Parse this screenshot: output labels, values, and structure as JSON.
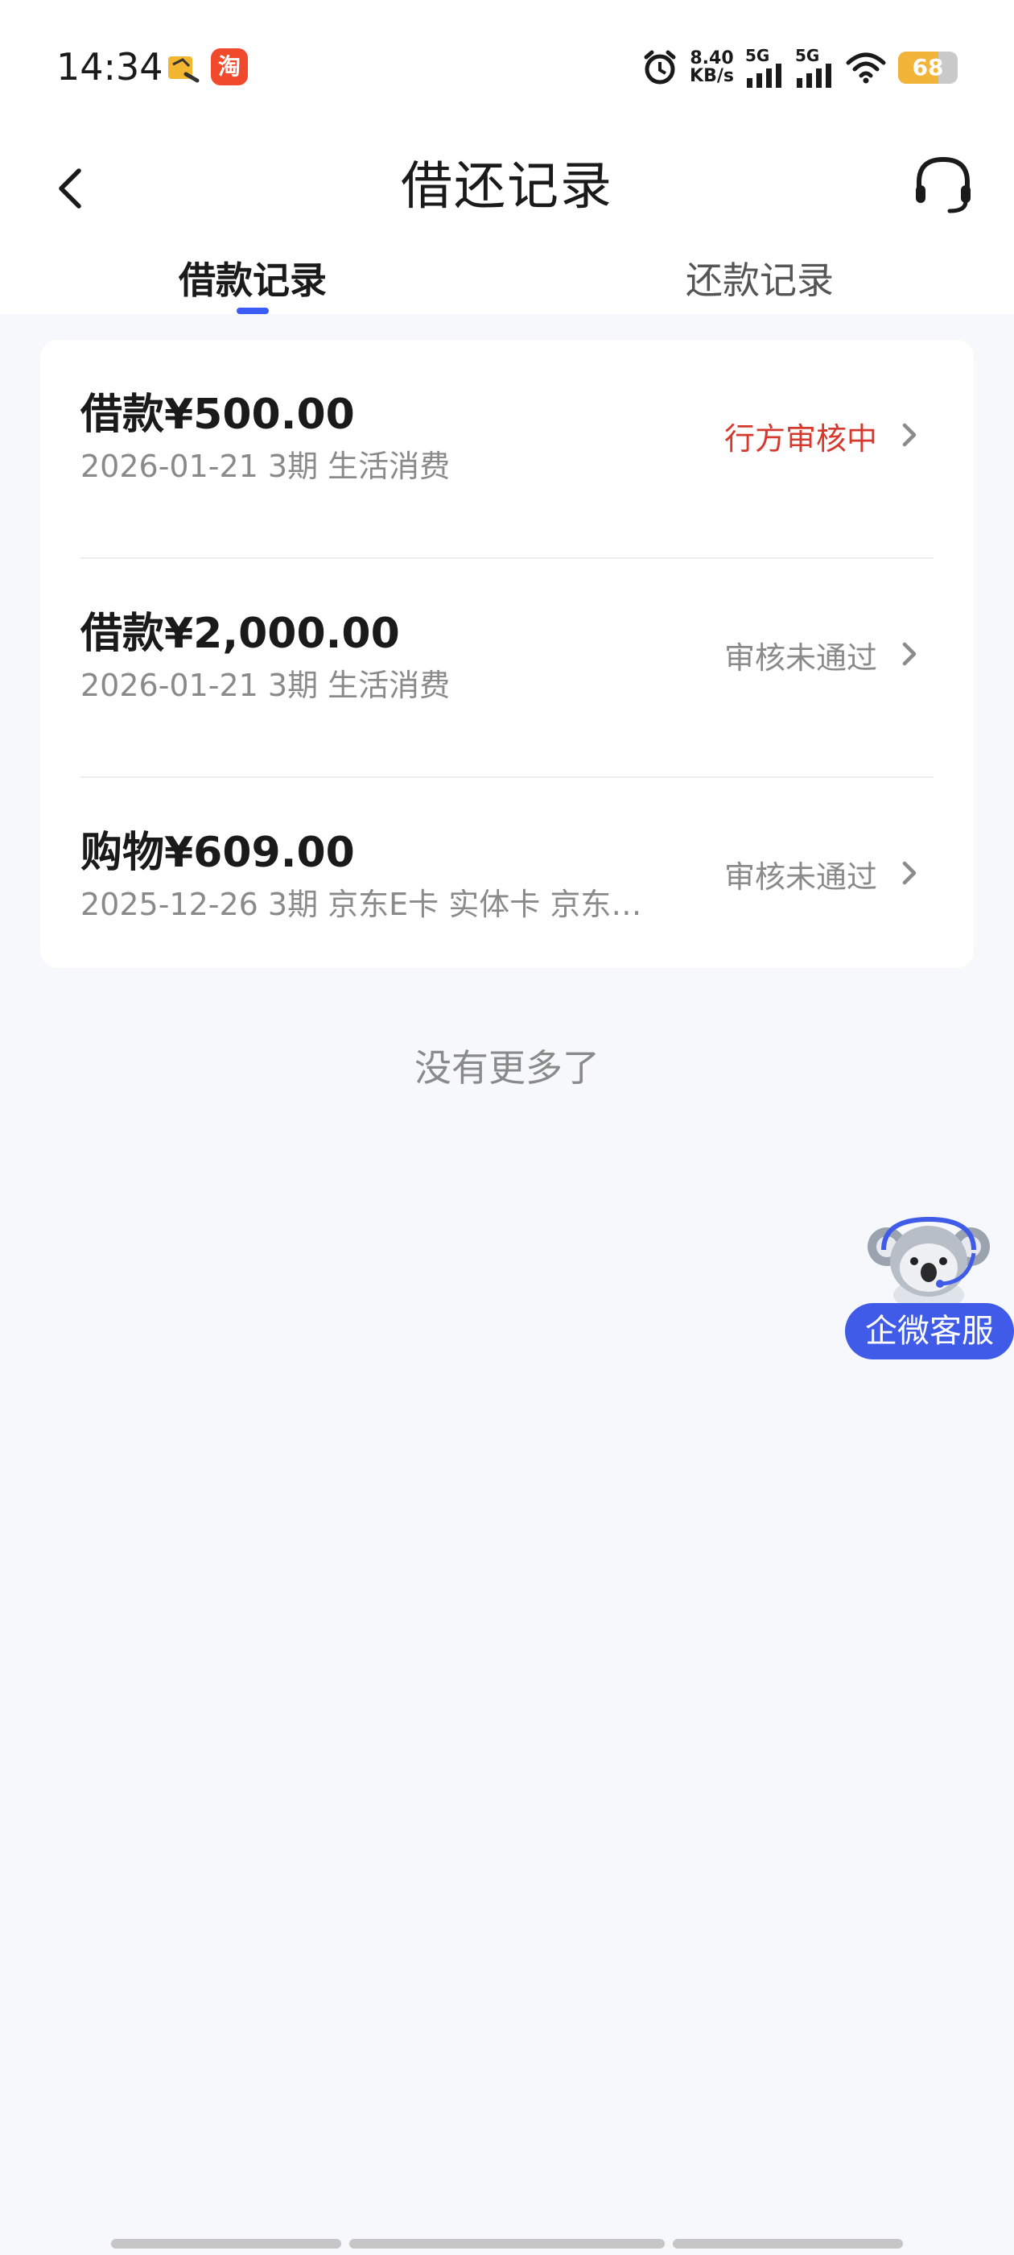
{
  "status_bar": {
    "time": "14:34",
    "app2_glyph": "淘",
    "net_speed_value": "8.40",
    "net_speed_unit": "KB/s",
    "signal1_label": "5G",
    "signal2_label": "5G",
    "battery": "68",
    "battery_level": 0.68
  },
  "header": {
    "title": "借还记录",
    "tabs": [
      {
        "label": "借款记录",
        "active": true
      },
      {
        "label": "还款记录",
        "active": false
      }
    ]
  },
  "records": [
    {
      "amount": "借款¥500.00",
      "meta": "2026-01-21 3期  生活消费",
      "status": "行方审核中",
      "status_color": "#d63a2e"
    },
    {
      "amount": "借款¥2,000.00",
      "meta": "2026-01-21 3期  生活消费",
      "status": "审核未通过",
      "status_color": "#8a8a8a"
    },
    {
      "amount": "购物¥609.00",
      "meta": "2025-12-26 3期  京东E卡 实体卡 京东…",
      "status": "审核未通过",
      "status_color": "#8a8a8a"
    }
  ],
  "list_footer": "没有更多了",
  "floating": {
    "label": "企微客服",
    "icon": "koala-mascot-icon"
  },
  "colors": {
    "accent": "#3b5cf6",
    "warning": "#d63a2e",
    "background": "#f7f8fc"
  }
}
